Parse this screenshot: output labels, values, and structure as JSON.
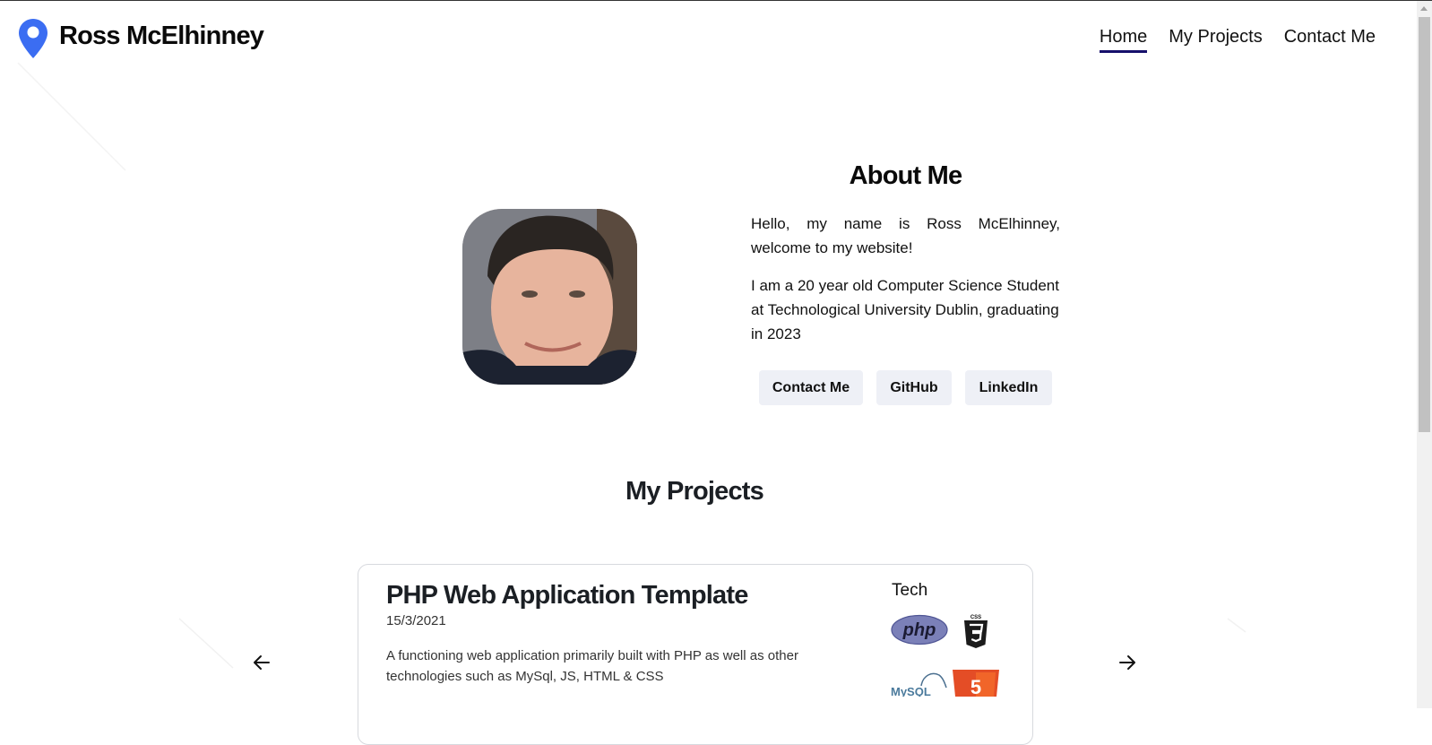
{
  "header": {
    "brand": "Ross McElhinney",
    "nav": [
      {
        "label": "Home",
        "active": true
      },
      {
        "label": "My Projects",
        "active": false
      },
      {
        "label": "Contact Me",
        "active": false
      }
    ]
  },
  "about": {
    "title": "About Me",
    "paragraph1": "Hello, my name is Ross McElhinney, welcome to my website!",
    "paragraph2": "I am a 20 year old Computer Science Student at Technological University Dublin, graduating in 2023",
    "buttons": {
      "contact": "Contact Me",
      "github": "GitHub",
      "linkedin": "LinkedIn"
    }
  },
  "projects": {
    "title": "My Projects",
    "card": {
      "title": "PHP Web Application Template",
      "date": "15/3/2021",
      "description": "A functioning web application primarily built with PHP as well as other technologies such as MySql, JS, HTML & CSS",
      "tech_label": "Tech",
      "tech_logo_text": {
        "php": "php",
        "css": "CSS",
        "html": "5",
        "mysql": "MySQL"
      }
    }
  },
  "icons": {
    "brand": "map-pin-icon",
    "prev": "arrow-left-icon",
    "next": "arrow-right-icon"
  },
  "colors": {
    "pin": "#3b6df2",
    "nav_active_underline": "#16106b",
    "button_bg": "#eef0f6",
    "php": "#7b80b8",
    "css3": "#1b1b1b",
    "html5": "#e44d26"
  }
}
